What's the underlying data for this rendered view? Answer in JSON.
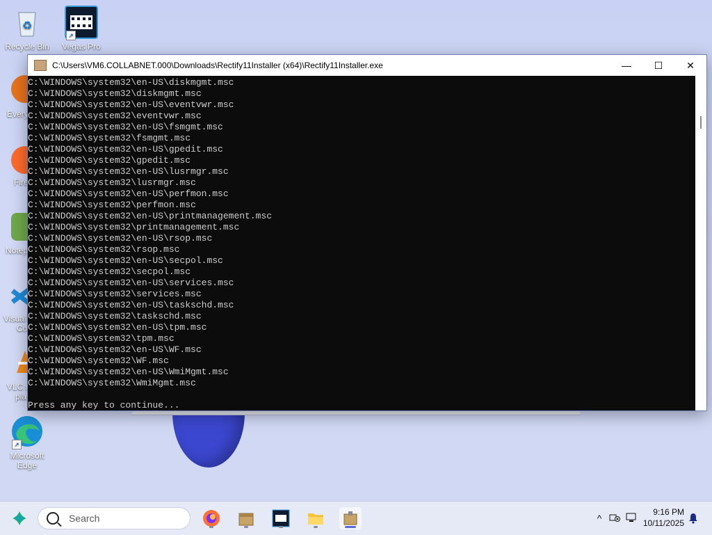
{
  "desktop": {
    "icons": [
      {
        "label": "Recycle Bin",
        "icon": "recycle-bin-icon"
      },
      {
        "label": "Vegas Pro",
        "icon": "vegas-pro-icon"
      },
      {
        "label": "Every",
        "icon": "everything-icon"
      },
      {
        "label": "Fire",
        "icon": "firefox-icon"
      },
      {
        "label": "Notep",
        "icon": "notepad-icon"
      },
      {
        "label": "Visual",
        "icon": "visual-studio-code-icon"
      },
      {
        "label": "Co",
        "icon": "visual-studio-code-icon"
      },
      {
        "label": "VLC r",
        "icon": "vlc-icon"
      },
      {
        "label": "pla",
        "icon": "vlc-icon"
      },
      {
        "label": "Microsoft Edge",
        "icon": "edge-icon"
      }
    ]
  },
  "console_window": {
    "title": "C:\\Users\\VM6.COLLABNET.000\\Downloads\\Rectify11Installer (x64)\\Rectify11Installer.exe",
    "controls": {
      "minimize": "—",
      "maximize": "☐",
      "close": "✕"
    },
    "lines": [
      "C:\\WINDOWS\\system32\\en-US\\diskmgmt.msc",
      "C:\\WINDOWS\\system32\\diskmgmt.msc",
      "C:\\WINDOWS\\system32\\en-US\\eventvwr.msc",
      "C:\\WINDOWS\\system32\\eventvwr.msc",
      "C:\\WINDOWS\\system32\\en-US\\fsmgmt.msc",
      "C:\\WINDOWS\\system32\\fsmgmt.msc",
      "C:\\WINDOWS\\system32\\en-US\\gpedit.msc",
      "C:\\WINDOWS\\system32\\gpedit.msc",
      "C:\\WINDOWS\\system32\\en-US\\lusrmgr.msc",
      "C:\\WINDOWS\\system32\\lusrmgr.msc",
      "C:\\WINDOWS\\system32\\en-US\\perfmon.msc",
      "C:\\WINDOWS\\system32\\perfmon.msc",
      "C:\\WINDOWS\\system32\\en-US\\printmanagement.msc",
      "C:\\WINDOWS\\system32\\printmanagement.msc",
      "C:\\WINDOWS\\system32\\en-US\\rsop.msc",
      "C:\\WINDOWS\\system32\\rsop.msc",
      "C:\\WINDOWS\\system32\\en-US\\secpol.msc",
      "C:\\WINDOWS\\system32\\secpol.msc",
      "C:\\WINDOWS\\system32\\en-US\\services.msc",
      "C:\\WINDOWS\\system32\\services.msc",
      "C:\\WINDOWS\\system32\\en-US\\taskschd.msc",
      "C:\\WINDOWS\\system32\\taskschd.msc",
      "C:\\WINDOWS\\system32\\en-US\\tpm.msc",
      "C:\\WINDOWS\\system32\\tpm.msc",
      "C:\\WINDOWS\\system32\\en-US\\WF.msc",
      "C:\\WINDOWS\\system32\\WF.msc",
      "C:\\WINDOWS\\system32\\en-US\\WmiMgmt.msc",
      "C:\\WINDOWS\\system32\\WmiMgmt.msc",
      "",
      "Press any key to continue..."
    ]
  },
  "taskbar": {
    "search_placeholder": "Search",
    "apps": [
      "start-icon",
      "firefox-icon",
      "package-icon",
      "vegas-pro-icon",
      "file-explorer-icon",
      "installer-icon"
    ],
    "tray": {
      "chevron": "^",
      "time": "9:16 PM",
      "date": "10/11/2025"
    },
    "colors": {
      "accent": "#5b6cd8",
      "windows_blue": "#0a64d8"
    }
  }
}
